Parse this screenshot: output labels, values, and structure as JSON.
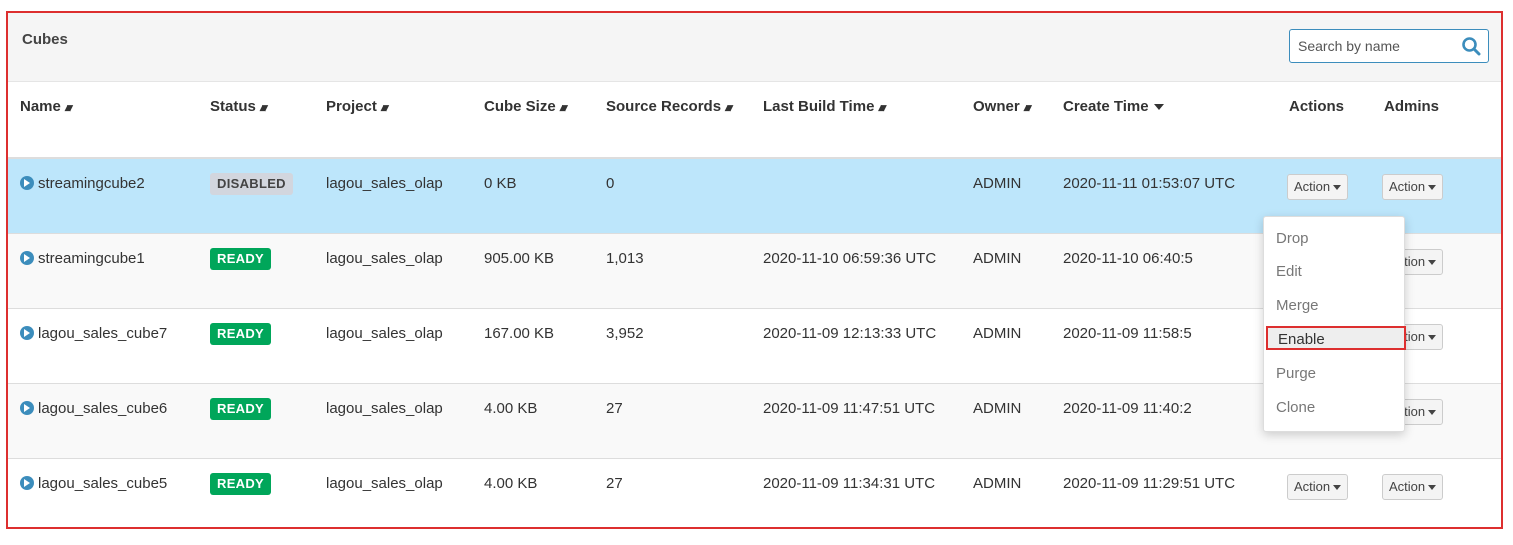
{
  "panel": {
    "title": "Cubes",
    "search_placeholder": "Search by name"
  },
  "columns": [
    {
      "label": "Name",
      "sort": "both"
    },
    {
      "label": "Status",
      "sort": "both"
    },
    {
      "label": "Project",
      "sort": "both"
    },
    {
      "label": "Cube Size",
      "sort": "both"
    },
    {
      "label": "Source Records",
      "sort": "both"
    },
    {
      "label": "Last Build Time",
      "sort": "both"
    },
    {
      "label": "Owner",
      "sort": "both"
    },
    {
      "label": "Create Time",
      "sort": "desc"
    },
    {
      "label": "Actions",
      "sort": ""
    },
    {
      "label": "Admins",
      "sort": ""
    }
  ],
  "rows": [
    {
      "name": "streamingcube2",
      "status": "DISABLED",
      "project": "lagou_sales_olap",
      "size": "0 KB",
      "records": "0",
      "last_build": "",
      "owner": "ADMIN",
      "created": "2020-11-11 01:53:07 UTC",
      "action": "Action",
      "admin_action": "Action"
    },
    {
      "name": "streamingcube1",
      "status": "READY",
      "project": "lagou_sales_olap",
      "size": "905.00 KB",
      "records": "1,013",
      "last_build": "2020-11-10 06:59:36 UTC",
      "owner": "ADMIN",
      "created": "2020-11-10 06:40:5",
      "action": "",
      "admin_action": "Action"
    },
    {
      "name": "lagou_sales_cube7",
      "status": "READY",
      "project": "lagou_sales_olap",
      "size": "167.00 KB",
      "records": "3,952",
      "last_build": "2020-11-09 12:13:33 UTC",
      "owner": "ADMIN",
      "created": "2020-11-09 11:58:5",
      "action": "",
      "admin_action": "Action"
    },
    {
      "name": "lagou_sales_cube6",
      "status": "READY",
      "project": "lagou_sales_olap",
      "size": "4.00 KB",
      "records": "27",
      "last_build": "2020-11-09 11:47:51 UTC",
      "owner": "ADMIN",
      "created": "2020-11-09 11:40:2",
      "action": "",
      "admin_action": "Action"
    },
    {
      "name": "lagou_sales_cube5",
      "status": "READY",
      "project": "lagou_sales_olap",
      "size": "4.00 KB",
      "records": "27",
      "last_build": "2020-11-09 11:34:31 UTC",
      "owner": "ADMIN",
      "created": "2020-11-09 11:29:51 UTC",
      "action": "Action",
      "admin_action": "Action"
    }
  ],
  "dropdown": {
    "items": [
      "Drop",
      "Edit",
      "Merge",
      "Enable",
      "Purge",
      "Clone"
    ],
    "active": "Enable"
  },
  "colors": {
    "selected_row": "#bde6fb",
    "ready": "#00a65a",
    "disabled": "#d2d6de",
    "highlight_border": "#dd2f2f",
    "accent": "#3c8dbc"
  }
}
